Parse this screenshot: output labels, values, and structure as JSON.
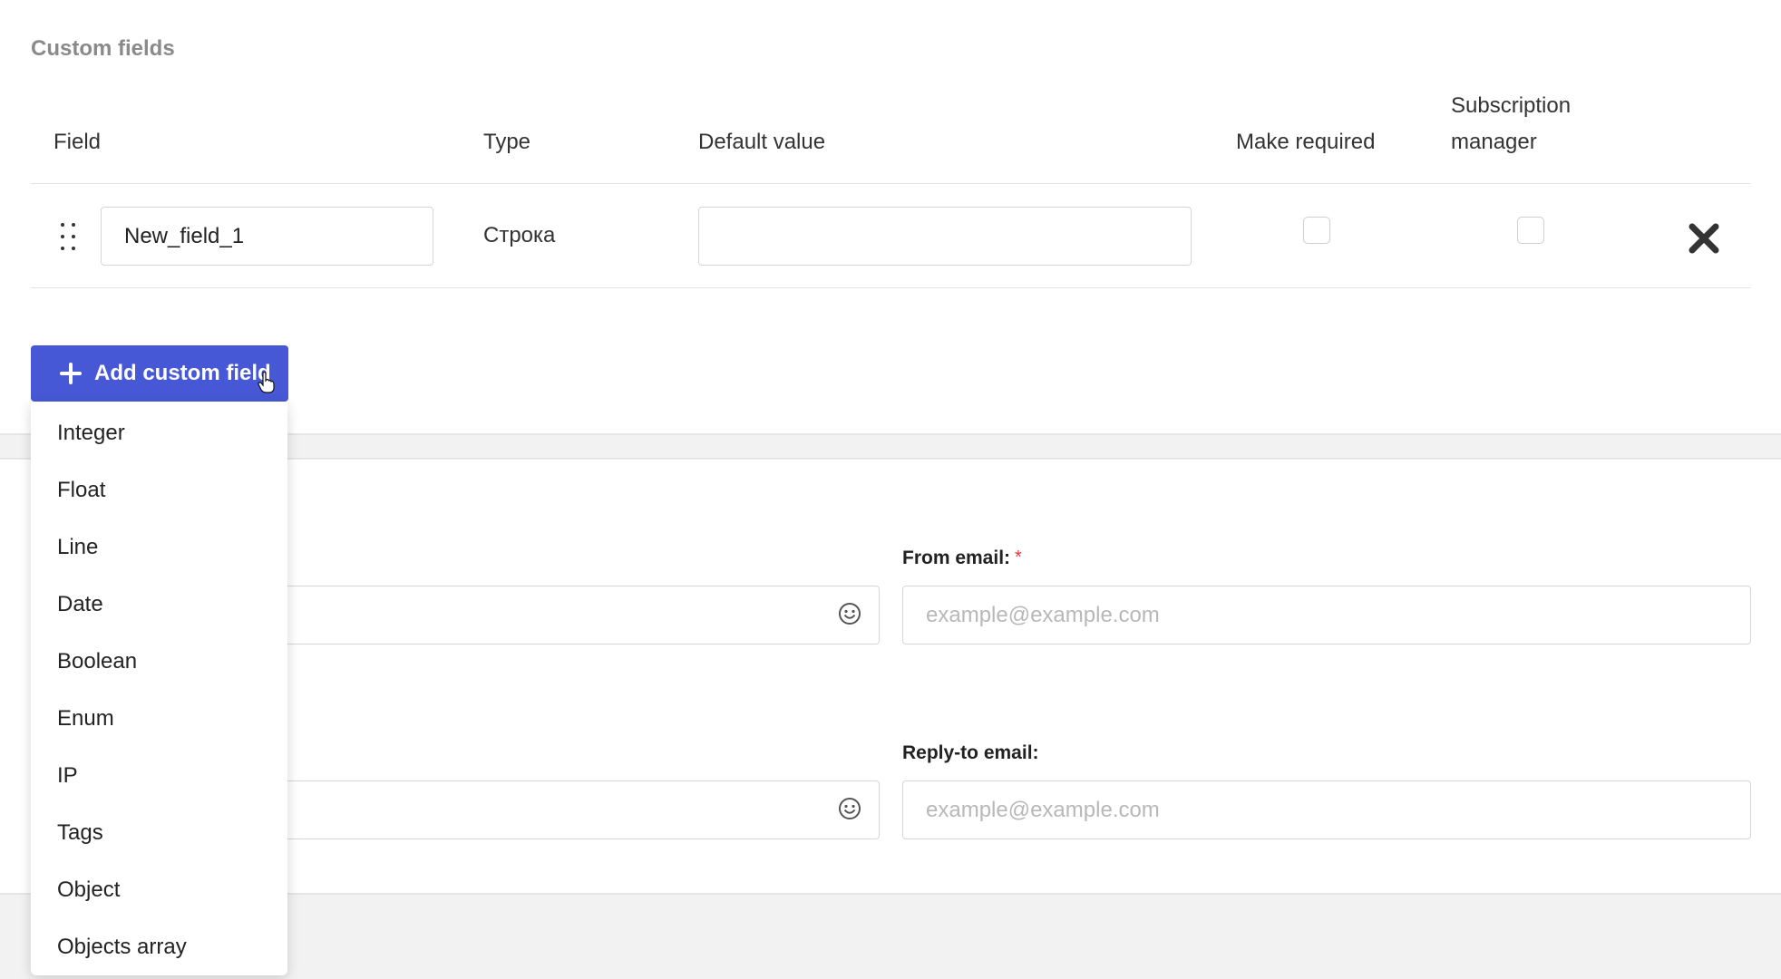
{
  "section": {
    "title": "Custom fields"
  },
  "table": {
    "headers": {
      "field": "Field",
      "type": "Type",
      "default_value": "Default value",
      "make_required": "Make required",
      "subscription_manager_line1": "Subscription",
      "subscription_manager_line2": "manager"
    },
    "rows": [
      {
        "field_value": "New_field_1",
        "type": "Строка",
        "default_value": "",
        "required": false,
        "subscription_manager": false
      }
    ]
  },
  "add_button": {
    "label": "Add custom field",
    "icon": "plus-icon"
  },
  "dropdown": {
    "items": [
      "Integer",
      "Float",
      "Line",
      "Date",
      "Boolean",
      "Enum",
      "IP",
      "Tags",
      "Object",
      "Objects array"
    ]
  },
  "form": {
    "from_email": {
      "label": "From email:",
      "required_mark": "*",
      "placeholder": "example@example.com"
    },
    "reply_to_email": {
      "label": "Reply-to email:",
      "placeholder": "example@example.com"
    }
  },
  "colors": {
    "primary": "#4758d6",
    "required": "#ee3333",
    "muted": "#8a8a8a"
  }
}
